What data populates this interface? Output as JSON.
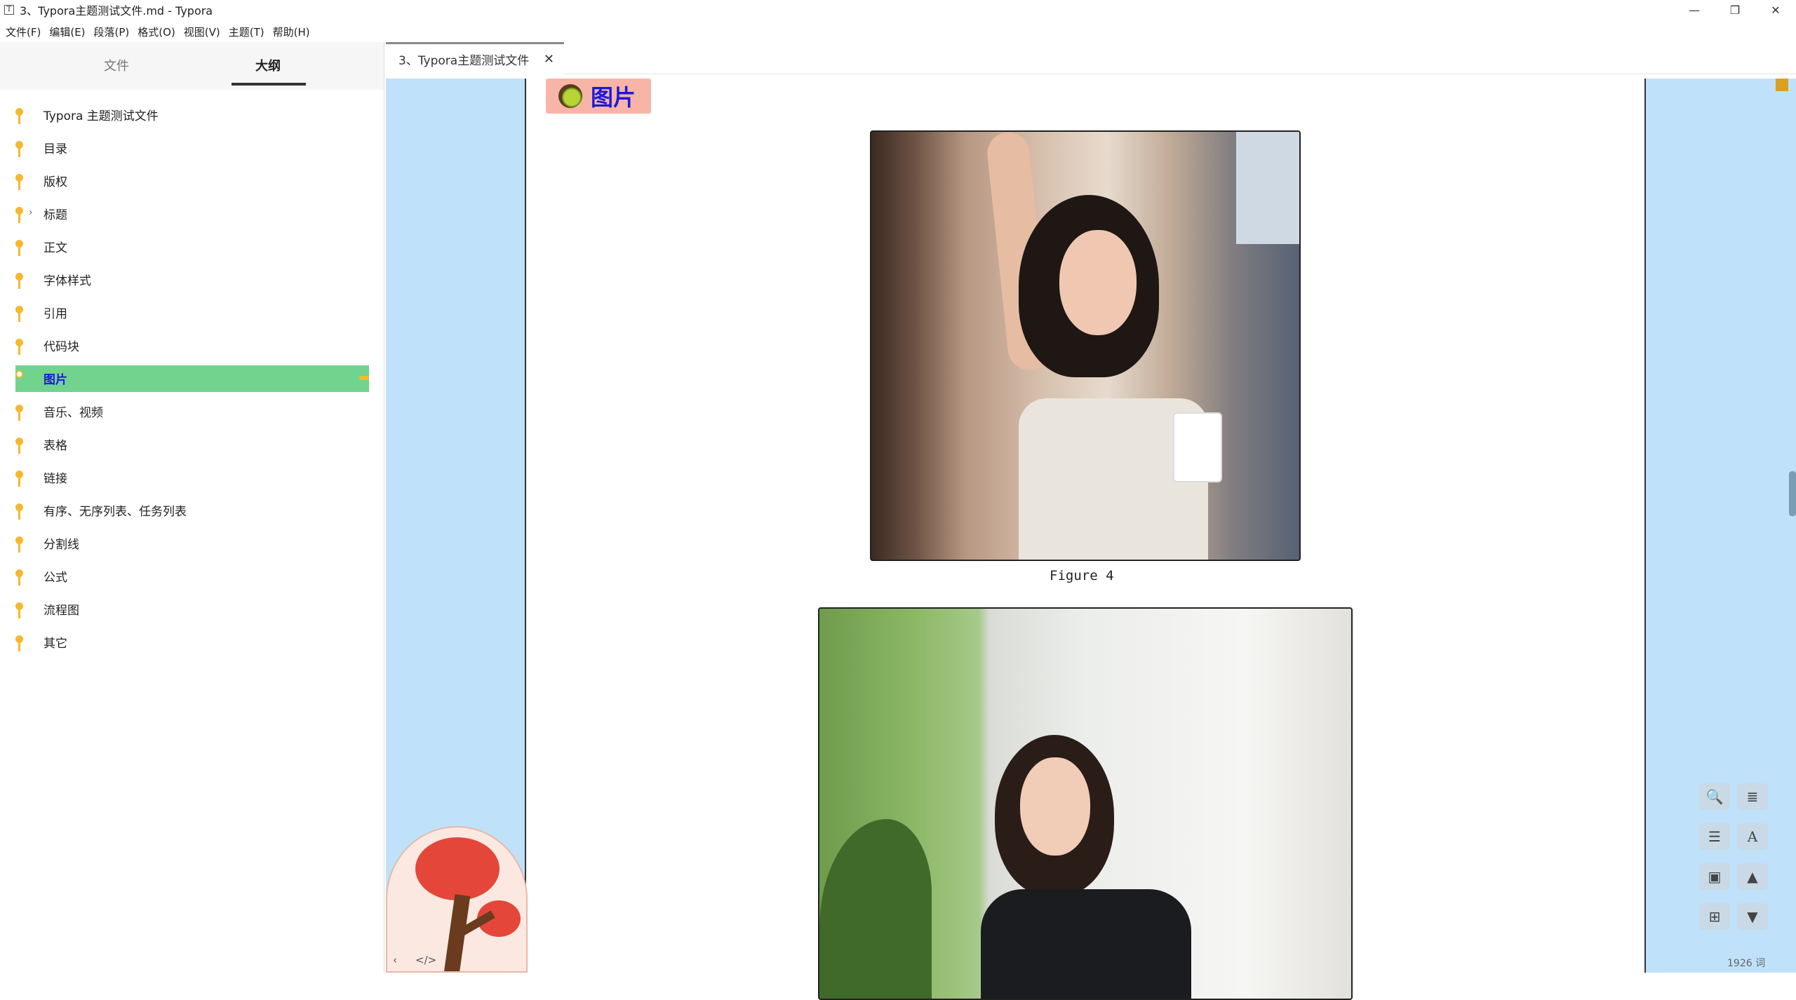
{
  "window": {
    "app_icon": "T",
    "title": "3、Typora主题测试文件.md - Typora",
    "controls": {
      "minimize": "—",
      "restore": "❐",
      "close": "✕"
    }
  },
  "menu": [
    "文件(F)",
    "编辑(E)",
    "段落(P)",
    "格式(O)",
    "视图(V)",
    "主题(T)",
    "帮助(H)"
  ],
  "sidebar": {
    "tabs": {
      "files": "文件",
      "outline": "大纲"
    },
    "active_tab": "outline",
    "outline": [
      {
        "label": "Typora 主题测试文件"
      },
      {
        "label": "目录"
      },
      {
        "label": "版权"
      },
      {
        "label": "标题",
        "collapsible": true
      },
      {
        "label": "正文"
      },
      {
        "label": "字体样式"
      },
      {
        "label": "引用"
      },
      {
        "label": "代码块"
      },
      {
        "label": "图片",
        "active": true
      },
      {
        "label": "音乐、视频"
      },
      {
        "label": "表格"
      },
      {
        "label": "链接"
      },
      {
        "label": "有序、无序列表、任务列表"
      },
      {
        "label": "分割线"
      },
      {
        "label": "公式"
      },
      {
        "label": "流程图"
      },
      {
        "label": "其它"
      }
    ]
  },
  "tabbar": {
    "tab_label": "3、Typora主题测试文件",
    "close": "✕"
  },
  "document": {
    "heading": "图片",
    "figure_caption": "Figure 4"
  },
  "avatar_controls": {
    "collapse": "‹",
    "source": "</>"
  },
  "toolbar": {
    "search": "🔍",
    "menu": "≣",
    "list": "☰",
    "font": "A",
    "image": "▣",
    "up": "▲",
    "tree": "⊞",
    "down": "▼"
  },
  "status": {
    "word_count": "1926 词"
  },
  "colors": {
    "accent_green": "#72d38e",
    "outline_dot": "#f5b82e",
    "margin_blue": "#bfe2fa",
    "heading_blue": "#1a1ad8",
    "heading_pill": "#f9b4a8"
  }
}
